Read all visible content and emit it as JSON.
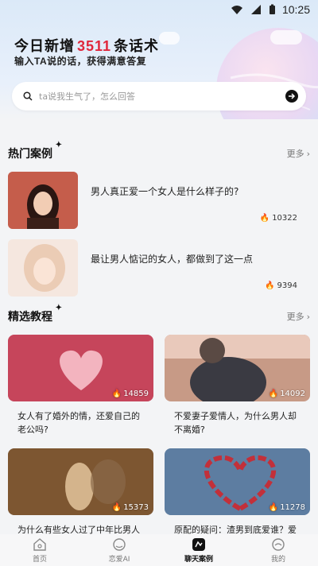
{
  "status_bar": {
    "time": "10:25"
  },
  "hero": {
    "headline_prefix": "今日新增",
    "headline_count": "3511",
    "headline_suffix": "条话术",
    "subline": "输入TA说的话，获得满意答复",
    "search_placeholder": "ta说我生气了，怎么回答"
  },
  "hot_cases": {
    "title": "热门案例",
    "more": "更多",
    "items": [
      {
        "title": "男人真正爱一个女人是什么样子的?",
        "likes": "10322"
      },
      {
        "title": "最让男人惦记的女人，都做到了这一点",
        "likes": "9394"
      }
    ]
  },
  "tutorials": {
    "title": "精选教程",
    "more": "更多",
    "items": [
      {
        "title": "女人有了婚外的情，还爱自己的老公吗?",
        "likes": "14859"
      },
      {
        "title": "不爱妻子爱情人，为什么男人却不离婚?",
        "likes": "14092"
      },
      {
        "title": "为什么有些女人过了中年比男人更",
        "likes": "15373"
      },
      {
        "title": "原配的疑问：渣男到底爱谁？爱我",
        "likes": "11278"
      }
    ]
  },
  "bottom_nav": {
    "items": [
      {
        "label": "首页"
      },
      {
        "label": "恋爱AI"
      },
      {
        "label": "聊天案例"
      },
      {
        "label": "我的"
      }
    ],
    "active_index": 2
  },
  "colors": {
    "accent": "#e0273c",
    "flame": "#e84a4a"
  }
}
